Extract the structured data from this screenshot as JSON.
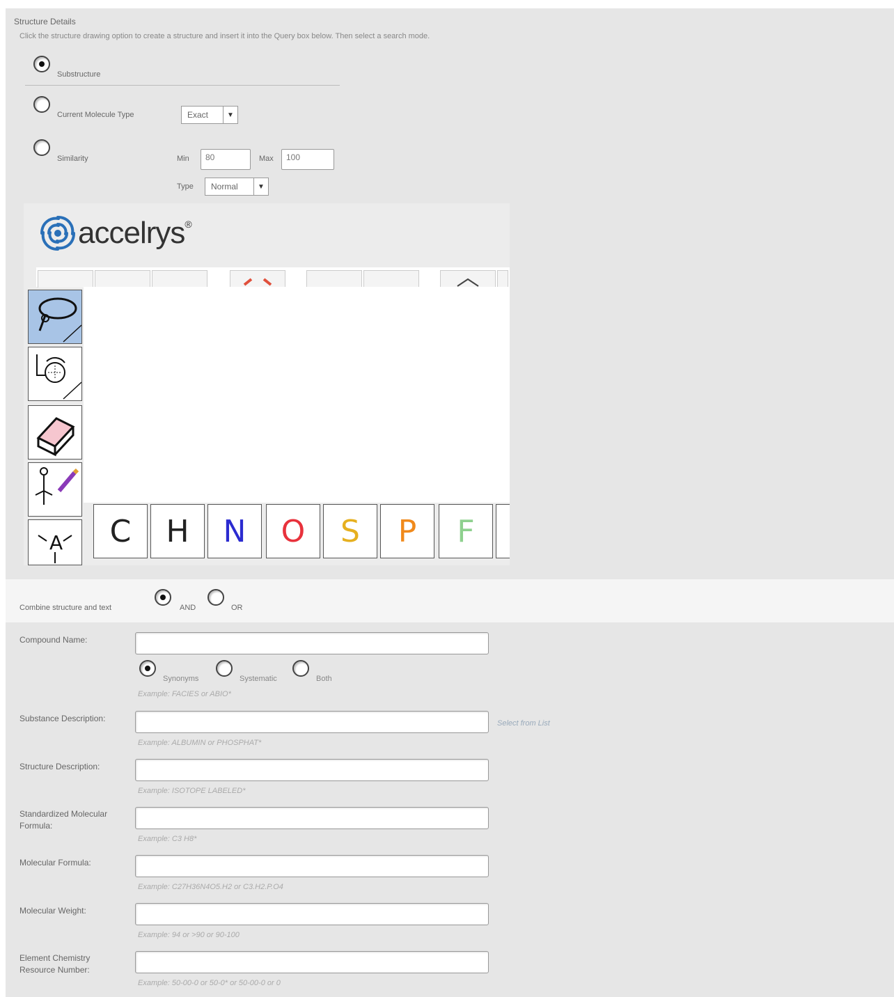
{
  "structure": {
    "section_title": "Structure Details",
    "instructions": "Click the structure drawing option to create a structure and insert it into the Query box below. Then select a search mode.",
    "modes": [
      {
        "label": "Substructure",
        "checked": true
      },
      {
        "label": "Current Molecule Type",
        "checked": false
      },
      {
        "label": "Similarity",
        "checked": false
      }
    ],
    "molecule_type_select": "Exact",
    "similarity": {
      "min_label": "Min",
      "min_value": "80",
      "max_label": "Max",
      "max_value": "100",
      "type_label": "Type",
      "type_value": "Normal"
    }
  },
  "editor": {
    "logo_text": "accelrys",
    "logo_mark": "®",
    "side_tools": [
      "lasso-select-icon",
      "rotate-select-icon",
      "eraser-icon",
      "atom-edit-icon",
      "atom-label-icon"
    ],
    "atoms": [
      {
        "symbol": "C",
        "color": "#222222"
      },
      {
        "symbol": "H",
        "color": "#222222"
      },
      {
        "symbol": "N",
        "color": "#2b2bd0"
      },
      {
        "symbol": "O",
        "color": "#e8323c"
      },
      {
        "symbol": "S",
        "color": "#e6b020"
      },
      {
        "symbol": "P",
        "color": "#f08a1c"
      },
      {
        "symbol": "F",
        "color": "#8ed08e"
      }
    ]
  },
  "combine": {
    "label": "Combine structure and text",
    "options": [
      {
        "label": "AND",
        "checked": true
      },
      {
        "label": "OR",
        "checked": false
      }
    ]
  },
  "fields": {
    "compound_name": {
      "label": "Compound Name:",
      "options": [
        {
          "label": "Synonyms",
          "checked": true
        },
        {
          "label": "Systematic",
          "checked": false
        },
        {
          "label": "Both",
          "checked": false
        }
      ],
      "example": "Example: FACIES or ABIO*"
    },
    "substance_description": {
      "label": "Substance Description:",
      "example": "Example: ALBUMIN or PHOSPHAT*",
      "link": "Select from List"
    },
    "structure_description": {
      "label": "Structure Description:",
      "example": "Example: ISOTOPE LABELED*"
    },
    "standardized_formula": {
      "label_line1": "Standardized Molecular",
      "label_line2": "Formula:",
      "example": "Example: C3 H8*"
    },
    "molecular_formula": {
      "label": "Molecular Formula:",
      "example": "Example: C27H36N4O5.H2 or C3.H2.P.O4"
    },
    "molecular_weight": {
      "label": "Molecular Weight:",
      "example": "Example: 94 or >90 or 90-100"
    },
    "cas_number": {
      "label_line1": "Element Chemistry",
      "label_line2": "Resource Number:",
      "example": "Example: 50-00-0 or 50-0* or 50-00-0 or 0"
    }
  }
}
